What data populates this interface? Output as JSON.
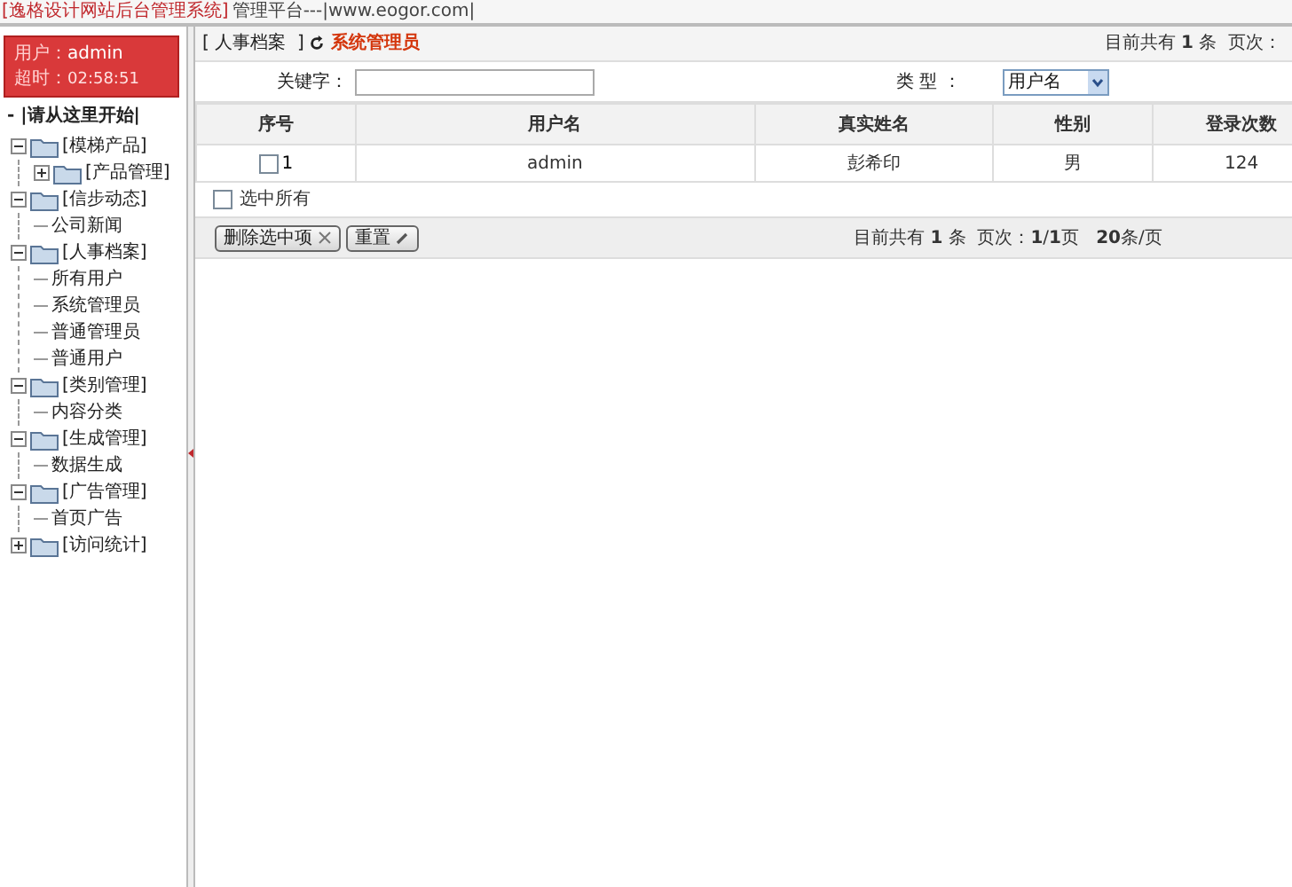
{
  "top_bar": {
    "system_name": "[逸格设计网站后台管理系统]",
    "platform": "管理平台---|www.eogor.com|"
  },
  "user_box": {
    "user_label": "用户：",
    "user": "admin",
    "timeout_label": "超时：",
    "timeout": "02:58:51"
  },
  "sidebar": {
    "start": "- |请从这里开始|",
    "tree": [
      {
        "label": "[模梯产品]",
        "kind": "folder",
        "expanded": true,
        "children": [
          {
            "label": "[产品管理]",
            "kind": "folder",
            "expanded": false
          }
        ]
      },
      {
        "label": "[信步动态]",
        "kind": "folder",
        "expanded": true,
        "children": [
          {
            "label": "公司新闻",
            "kind": "page"
          }
        ]
      },
      {
        "label": "[人事档案]",
        "kind": "folder",
        "expanded": true,
        "children": [
          {
            "label": "所有用户",
            "kind": "page"
          },
          {
            "label": "系统管理员",
            "kind": "page"
          },
          {
            "label": "普通管理员",
            "kind": "page"
          },
          {
            "label": "普通用户",
            "kind": "page"
          }
        ]
      },
      {
        "label": "[类别管理]",
        "kind": "folder",
        "expanded": true,
        "children": [
          {
            "label": "内容分类",
            "kind": "page"
          }
        ]
      },
      {
        "label": "[生成管理]",
        "kind": "folder",
        "expanded": true,
        "children": [
          {
            "label": "数据生成",
            "kind": "page"
          }
        ]
      },
      {
        "label": "[广告管理]",
        "kind": "folder",
        "expanded": true,
        "children": [
          {
            "label": "首页广告",
            "kind": "page"
          }
        ]
      },
      {
        "label": "[访问统计]",
        "kind": "folder",
        "expanded": false
      }
    ]
  },
  "breadcrumb": {
    "section": "[ 人事档案  ]",
    "current": "系统管理员"
  },
  "top_stats": "目前共有 **1** 条  页次：",
  "search": {
    "keyword_label": "关键字：",
    "type_label": "类 型 ：",
    "type_value": "用户名"
  },
  "table": {
    "columns": [
      "序号",
      "用户名",
      "真实姓名",
      "性别",
      "登录次数"
    ],
    "rows": [
      {
        "checked": false,
        "cells": [
          "1",
          "admin",
          "彭希印",
          "男",
          "124"
        ]
      }
    ]
  },
  "select_all": {
    "label": "选中所有",
    "checked": false
  },
  "buttons": [
    "删除选中项",
    "重置"
  ],
  "pagination": "目前共有 **1** 条  页次：**1**/**1**页   **20**条/页"
}
